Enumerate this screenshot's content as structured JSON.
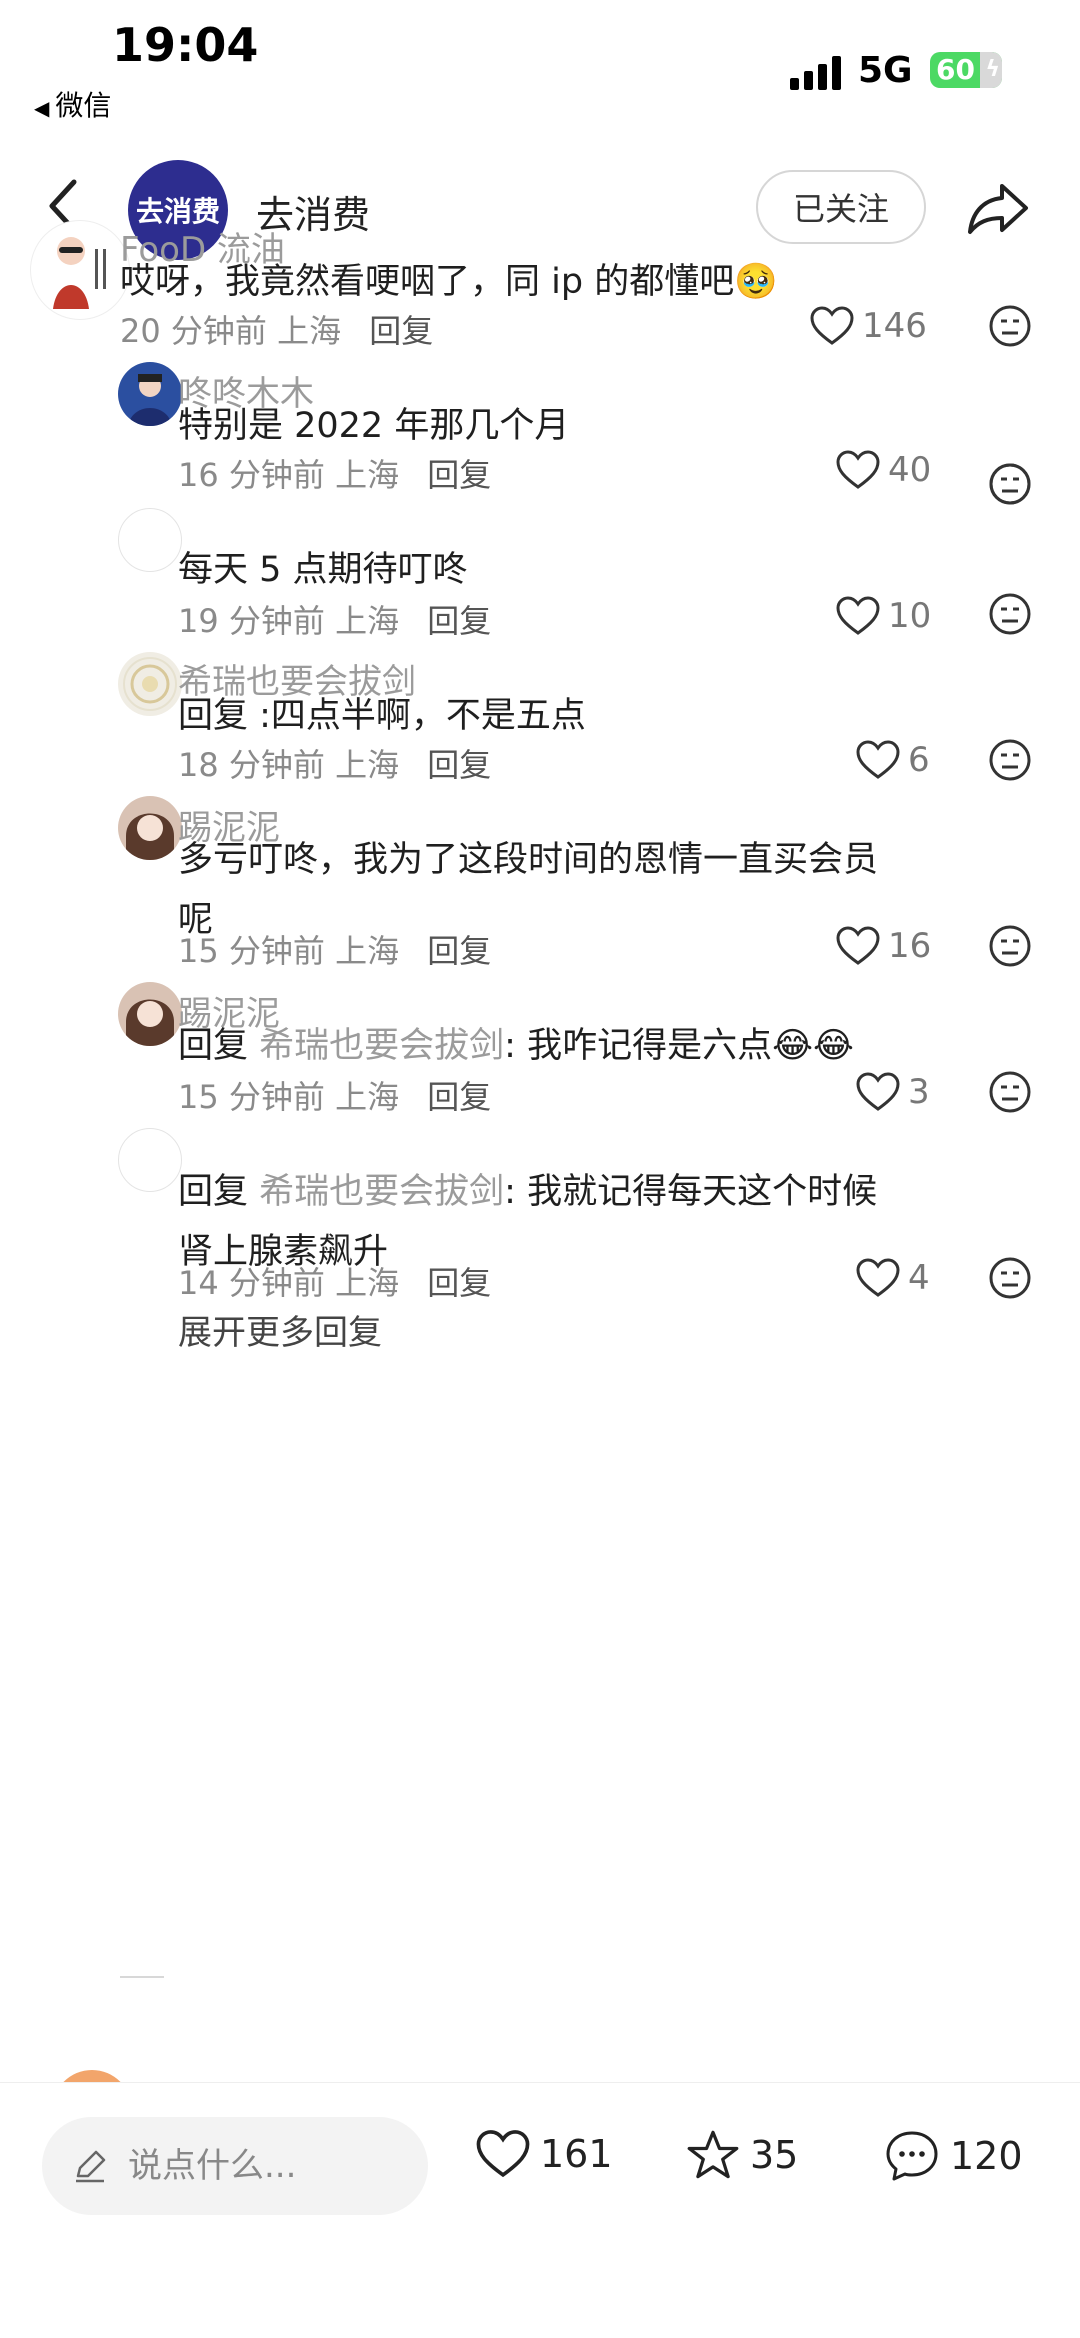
{
  "status_bar": {
    "time": "19:04",
    "back_app": "微信",
    "network": "5G",
    "battery": "60"
  },
  "header": {
    "account_avatar_text": "去消费",
    "account_name": "去消费",
    "follow_label": "已关注"
  },
  "comments": [
    {
      "user": "FooD 流油",
      "text": "哎呀，我竟然看哽咽了，同 ip 的都懂吧🥹",
      "time": "20 分钟前",
      "location": "上海",
      "reply": "回复",
      "likes": "146"
    },
    {
      "user": "咚咚木木",
      "text": "特别是 2022 年那几个月",
      "time": "16 分钟前",
      "location": "上海",
      "reply": "回复",
      "likes": "40"
    },
    {
      "user": "",
      "text": "每天 5 点期待叮咚",
      "time": "19 分钟前",
      "location": "上海",
      "reply": "回复",
      "likes": "10"
    },
    {
      "user": "希瑞也要会拔剑",
      "text_prefix": "回复 ",
      "text": ":四点半啊，不是五点",
      "time": "18 分钟前",
      "location": "上海",
      "reply": "回复",
      "likes": "6"
    },
    {
      "user": "踢泥泥",
      "text_line1": "多亏叮咚，我为了这段时间的恩情一直买会员",
      "text_line2": "呢",
      "time": "15 分钟前",
      "location": "上海",
      "reply": "回复",
      "likes": "16"
    },
    {
      "user": "踢泥泥",
      "text_prefix": "回复 ",
      "quote": "希瑞也要会拔剑",
      "text": ": 我咋记得是六点😂😂",
      "time": "15 分钟前",
      "location": "上海",
      "reply": "回复",
      "likes": "3"
    },
    {
      "user": "",
      "text_prefix": "回复 ",
      "quote": "希瑞也要会拔剑",
      "text_line1": ": 我就记得每天这个时候",
      "text_line2": "肾上腺素飙升",
      "time": "14 分钟前",
      "location": "上海",
      "reply": "回复",
      "likes": "4"
    }
  ],
  "expand_label": "展开更多回复",
  "bottom_bar": {
    "input_placeholder": "说点什么...",
    "likes": "161",
    "favorites": "35",
    "comments": "120"
  }
}
